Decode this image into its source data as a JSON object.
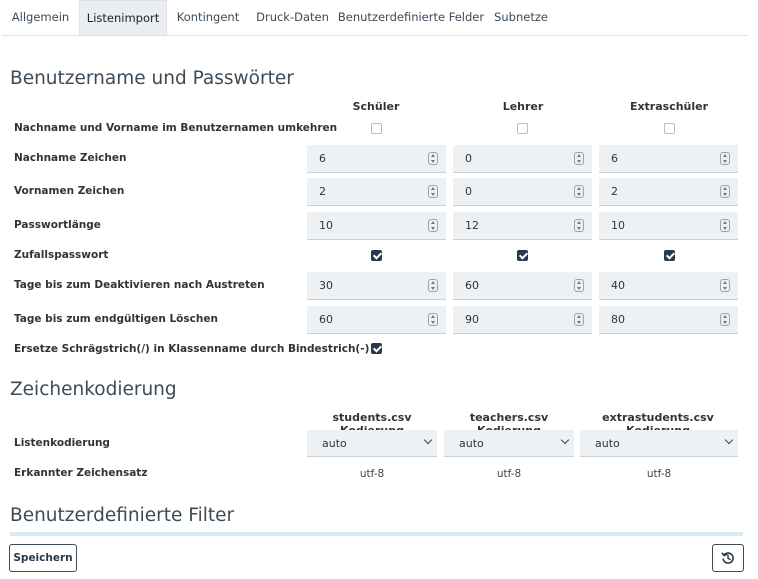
{
  "tabs": [
    {
      "label": "Allgemein",
      "active": false
    },
    {
      "label": "Listenimport",
      "active": true
    },
    {
      "label": "Kontingent",
      "active": false
    },
    {
      "label": "Druck-Daten",
      "active": false
    },
    {
      "label": "Benutzerdefinierte Felder",
      "active": false
    },
    {
      "label": "Subnetze",
      "active": false
    }
  ],
  "section1": {
    "title": "Benutzername und Passwörter",
    "columns": [
      "Schüler",
      "Lehrer",
      "Extraschüler"
    ],
    "rows": {
      "reverse": {
        "label": "Nachname und Vorname im Benutzernamen umkehren",
        "values": [
          false,
          false,
          false
        ]
      },
      "lastname_chars": {
        "label": "Nachname Zeichen",
        "values": [
          "6",
          "0",
          "6"
        ]
      },
      "firstname_chars": {
        "label": "Vornamen Zeichen",
        "values": [
          "2",
          "0",
          "2"
        ]
      },
      "pw_length": {
        "label": "Passwortlänge",
        "values": [
          "10",
          "12",
          "10"
        ]
      },
      "random_pw": {
        "label": "Zufallspasswort",
        "values": [
          true,
          true,
          true
        ]
      },
      "deactivate_days": {
        "label": "Tage bis zum Deaktivieren nach Austreten",
        "values": [
          "30",
          "60",
          "40"
        ]
      },
      "delete_days": {
        "label": "Tage bis zum endgültigen Löschen",
        "values": [
          "60",
          "90",
          "80"
        ]
      },
      "replace_slash": {
        "label": "Ersetze Schrägstrich(/) in Klassenname durch Bindestrich(-)",
        "value": true
      }
    }
  },
  "section2": {
    "title": "Zeichenkodierung",
    "columns": [
      "students.csv Kodierung",
      "teachers.csv Kodierung",
      "extrastudents.csv Kodierung"
    ],
    "encoding_label": "Listenkodierung",
    "encoding_values": [
      "auto",
      "auto",
      "auto"
    ],
    "detected_label": "Erkannter Zeichensatz",
    "detected_values": [
      "utf-8",
      "utf-8",
      "utf-8"
    ]
  },
  "section3": {
    "title": "Benutzerdefinierte Filter"
  },
  "footer": {
    "save_label": "Speichern",
    "reset_icon": "history-icon"
  },
  "colors": {
    "accent": "#26394d",
    "field_bg": "#eef1f4",
    "progress": "#d6ebf4"
  }
}
